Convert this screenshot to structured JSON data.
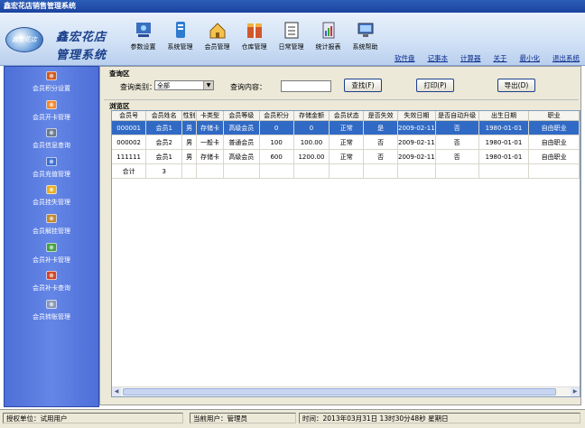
{
  "window": {
    "title": "鑫宏花店销售管理系统"
  },
  "logo": {
    "badge": "鑫宏花店",
    "line1": "鑫宏花店",
    "line2": "管理系统"
  },
  "toolbar": [
    {
      "label": "参数设置",
      "icon": "parameter-settings-icon"
    },
    {
      "label": "系统管理",
      "icon": "system-management-icon"
    },
    {
      "label": "会员管理",
      "icon": "member-management-icon"
    },
    {
      "label": "仓库管理",
      "icon": "warehouse-icon"
    },
    {
      "label": "日常管理",
      "icon": "daily-management-icon"
    },
    {
      "label": "统计报表",
      "icon": "statistics-report-icon"
    },
    {
      "label": "系统帮助",
      "icon": "system-help-icon"
    }
  ],
  "links": [
    "软件盘",
    "记事本",
    "计算器",
    "关于",
    "最小化",
    "退出系统"
  ],
  "sidebar": [
    {
      "label": "会员积分设置",
      "icon": "points-settings-icon"
    },
    {
      "label": "会员开卡管理",
      "icon": "open-card-icon"
    },
    {
      "label": "会员信息查询",
      "icon": "info-query-icon"
    },
    {
      "label": "会员充值管理",
      "icon": "recharge-icon"
    },
    {
      "label": "会员挂失管理",
      "icon": "report-loss-icon"
    },
    {
      "label": "会员解挂管理",
      "icon": "unlock-icon"
    },
    {
      "label": "会员补卡管理",
      "icon": "reissue-card-icon"
    },
    {
      "label": "会员补卡查询",
      "icon": "reissue-query-icon"
    },
    {
      "label": "会员转账管理",
      "icon": "transfer-icon"
    }
  ],
  "query": {
    "title": "查询区",
    "category_label": "查询类别：",
    "category_value": "全部",
    "content_label": "查询内容：",
    "content_value": "",
    "search_button": "查找(F)",
    "print_button": "打印(P)",
    "export_button": "导出(D)"
  },
  "browse": {
    "title": "浏览区",
    "columns": [
      "会员号",
      "会员姓名",
      "性别",
      "卡类型",
      "会员等级",
      "会员积分",
      "存储金额",
      "会员状态",
      "是否失效",
      "失效日期",
      "是否自动升级",
      "出生日期",
      "职业"
    ],
    "rows": [
      [
        "000001",
        "会员1",
        "男",
        "存储卡",
        "高级会员",
        "0",
        "0",
        "正常",
        "是",
        "2009-02-11",
        "否",
        "1980-01-01",
        "自由职业"
      ],
      [
        "000002",
        "会员2",
        "男",
        "一般卡",
        "普通会员",
        "100",
        "100.00",
        "正常",
        "否",
        "2009-02-11",
        "否",
        "1980-01-01",
        "自由职业"
      ],
      [
        "111111",
        "会员1",
        "男",
        "存储卡",
        "高级会员",
        "600",
        "1200.00",
        "正常",
        "否",
        "2009-02-11",
        "否",
        "1980-01-01",
        "自由职业"
      ]
    ],
    "total": {
      "label": "合计",
      "count": "3"
    },
    "selected_row": 0
  },
  "status": {
    "unit": "授权单位：试用用户",
    "user": "当前用户：管理员",
    "time": "时间：2013年03月31日  13时30分48秒  星期日"
  },
  "colors": {
    "selection": "#316ac5",
    "sidebar": "#5a7ae0",
    "titlebar": "#2b5db8"
  }
}
